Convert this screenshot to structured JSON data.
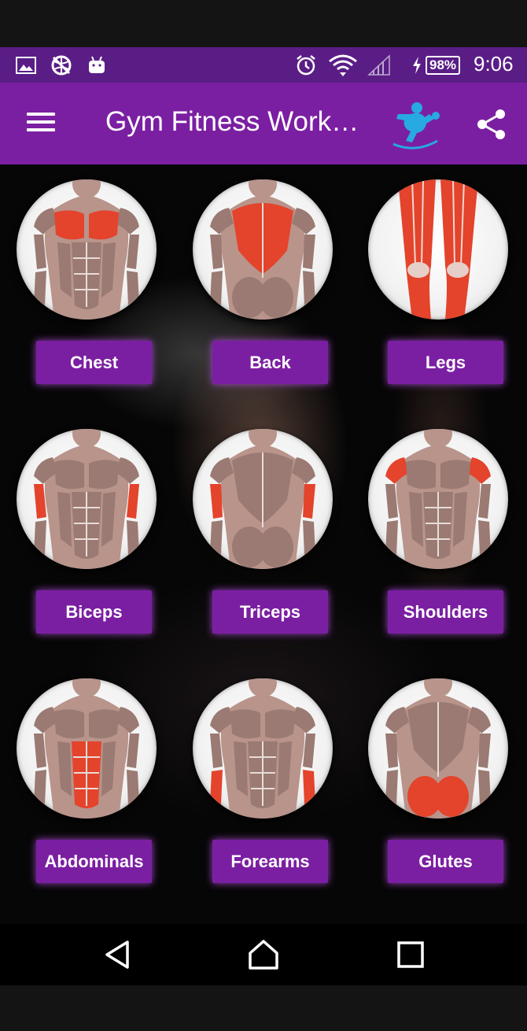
{
  "status_bar": {
    "time": "9:06",
    "battery": "98%",
    "icons": [
      "image-icon",
      "globe-icon",
      "android-icon",
      "alarm-icon",
      "wifi-icon",
      "signal-icon",
      "charging-icon"
    ]
  },
  "app_bar": {
    "title": "Gym Fitness Work…",
    "menu_icon": "hamburger-menu-icon",
    "logo_icon": "fitness-logo-icon",
    "share_icon": "share-icon"
  },
  "muscle_groups": [
    {
      "label": "Chest",
      "view": "front",
      "highlight": "chest"
    },
    {
      "label": "Back",
      "view": "back",
      "highlight": "back"
    },
    {
      "label": "Legs",
      "view": "legs",
      "highlight": "legs"
    },
    {
      "label": "Biceps",
      "view": "front",
      "highlight": "biceps"
    },
    {
      "label": "Triceps",
      "view": "back",
      "highlight": "triceps"
    },
    {
      "label": "Shoulders",
      "view": "front",
      "highlight": "shoulders"
    },
    {
      "label": "Abdominals",
      "view": "front",
      "highlight": "abs"
    },
    {
      "label": "Forearms",
      "view": "front",
      "highlight": "forearms"
    },
    {
      "label": "Glutes",
      "view": "back",
      "highlight": "glutes"
    }
  ],
  "nav_bar": {
    "icons": [
      "back-icon",
      "home-icon",
      "recents-icon"
    ]
  },
  "colors": {
    "status_bar": "#5a1d86",
    "app_bar": "#7b1fa2",
    "button": "#7b1fa2",
    "highlight_muscle": "#e4432c",
    "muscle_base": "#9a7a72"
  }
}
